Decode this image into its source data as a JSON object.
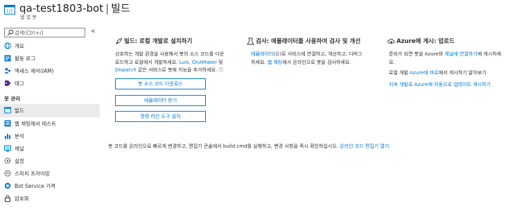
{
  "header": {
    "resource_name": "qa-test1803-bot",
    "separator": "|",
    "page_title": "빌드",
    "subtitle": "웹 앱 봇"
  },
  "sidebar": {
    "search_placeholder": "검색(Ctrl+/)",
    "collapse_glyph": "«",
    "top_items": [
      {
        "label": "개요",
        "icon": "globe-icon"
      },
      {
        "label": "활동 로그",
        "icon": "activity-log-icon"
      },
      {
        "label": "액세스 제어(IAM)",
        "icon": "iam-icon"
      },
      {
        "label": "태그",
        "icon": "tag-icon"
      }
    ],
    "section_title": "봇 관리",
    "bot_items": [
      {
        "label": "빌드",
        "icon": "build-icon",
        "active": true
      },
      {
        "label": "웹 채팅에서 테스트",
        "icon": "web-chat-icon"
      },
      {
        "label": "분석",
        "icon": "analytics-icon"
      },
      {
        "label": "채널",
        "icon": "channels-icon"
      },
      {
        "label": "설정",
        "icon": "settings-icon"
      },
      {
        "label": "스피치 프라이밍",
        "icon": "speech-priming-icon"
      },
      {
        "label": "Bot Service 가격",
        "icon": "pricing-icon"
      },
      {
        "label": "암호화",
        "icon": "encryption-icon"
      }
    ]
  },
  "cards": {
    "local": {
      "title": "빌드: 로컬 개발로 설치하기",
      "text1": "선호하는 개발 환경을 사용해서 봇의 소스 코드를 다운",
      "text2": "로드하고 로컬에서 개발하세요.",
      "link_luis": "Luis",
      "comma": ",",
      "link_qna": "QnAMaker",
      "and": "및",
      "link_dispatch": "Dispatch",
      "text3": "같은 서비스로 봇에 지능을 추가하세요.",
      "info_glyph": "ⓘ",
      "buttons": [
        "봇 소스 코드 다운로드",
        "에뮬레이터 받기",
        "명령 라인 도구 설치"
      ]
    },
    "test": {
      "title": "검사: 에뮬레이터를 사용하여 검사 및 개선",
      "link_emulator": "에뮬레이터",
      "text1": "(으)로 서비스에 연결하고, 개선하고, 디버그",
      "text2": "하세요.",
      "link_webchat": "웹 채팅",
      "text3": "에서 온라인으로 봇을 검사하세요."
    },
    "publish": {
      "title": "Azure에 게시: 업로드",
      "text1": "준비가 되면 봇을 Azure와",
      "link_channel": "채널에 연결하기",
      "text2": "에 게시하세",
      "text3": "요.",
      "line2_pre": "로컬 개발",
      "link_azure": "Azure에 바로",
      "line2_post": "에서 게시하기 알아보기",
      "link_cd": "지속 개발로 Azure에 자동으로 업데이트 게시하기"
    }
  },
  "footer": {
    "text": "봇 코드를 온라인으로 빠르게 변경하고, 편집기 콘솔에서 build.cmd를 실행하고, 변경 사항을 즉시 확인하십시오.",
    "link": "온라인 코드 편집기 열기"
  }
}
